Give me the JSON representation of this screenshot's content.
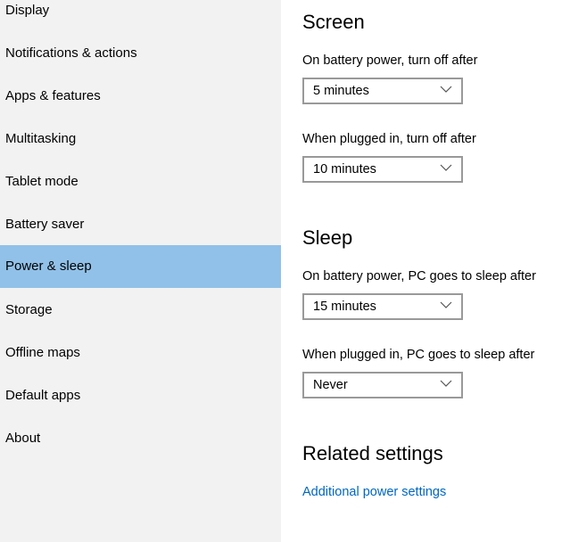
{
  "sidebar": {
    "items": [
      {
        "label": "Display"
      },
      {
        "label": "Notifications & actions"
      },
      {
        "label": "Apps & features"
      },
      {
        "label": "Multitasking"
      },
      {
        "label": "Tablet mode"
      },
      {
        "label": "Battery saver"
      },
      {
        "label": "Power & sleep",
        "selected": true
      },
      {
        "label": "Storage"
      },
      {
        "label": "Offline maps"
      },
      {
        "label": "Default apps"
      },
      {
        "label": "About"
      }
    ]
  },
  "screen": {
    "title": "Screen",
    "battery_label": "On battery power, turn off after",
    "battery_value": "5 minutes",
    "plugged_label": "When plugged in, turn off after",
    "plugged_value": "10 minutes"
  },
  "sleep": {
    "title": "Sleep",
    "battery_label": "On battery power, PC goes to sleep after",
    "battery_value": "15 minutes",
    "plugged_label": "When plugged in, PC goes to sleep after",
    "plugged_value": "Never"
  },
  "related": {
    "title": "Related settings",
    "link": "Additional power settings"
  },
  "colors": {
    "selected": "#91c1e8",
    "sidebar_bg": "#f2f2f2",
    "link": "#0067c0"
  }
}
